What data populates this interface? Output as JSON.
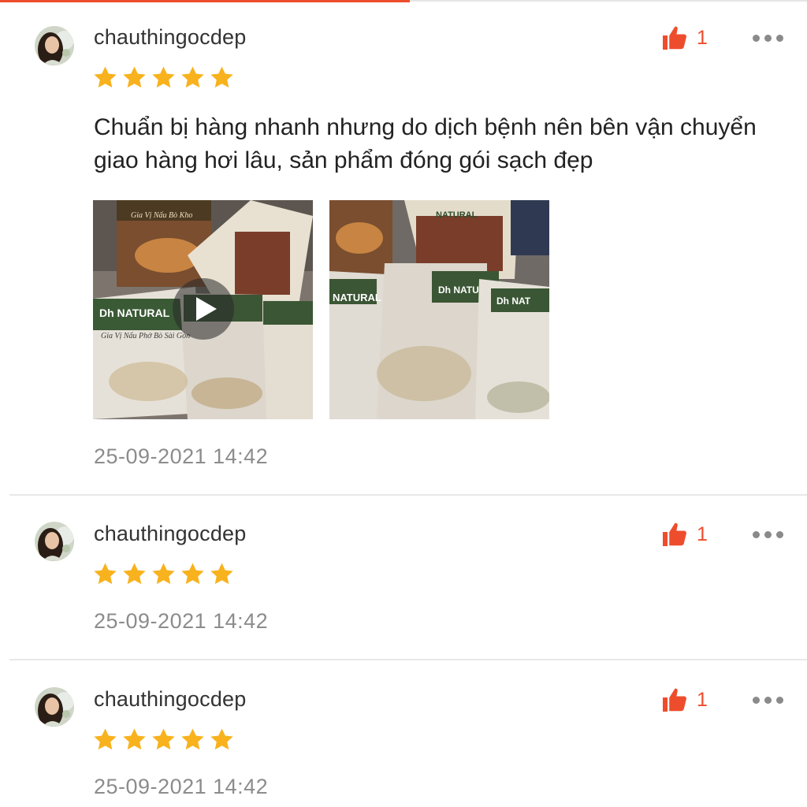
{
  "colors": {
    "accent": "#ee4d2d",
    "star": "#f8b21d",
    "text": "#222222",
    "muted": "#8c8c8c"
  },
  "reviews": [
    {
      "username": "chauthingocdep",
      "rating": 5,
      "likes": "1",
      "comment": "Chuẩn bị hàng nhanh nhưng do dịch bệnh nên bên vận chuyển giao hàng hơi lâu, sản phẩm đóng gói sạch đẹp",
      "media": [
        {
          "type": "video",
          "icon": "play-icon"
        },
        {
          "type": "image"
        }
      ],
      "timestamp": "25-09-2021 14:42"
    },
    {
      "username": "chauthingocdep",
      "rating": 5,
      "likes": "1",
      "timestamp": "25-09-2021 14:42"
    },
    {
      "username": "chauthingocdep",
      "rating": 5,
      "likes": "1",
      "timestamp": "25-09-2021 14:42"
    }
  ]
}
